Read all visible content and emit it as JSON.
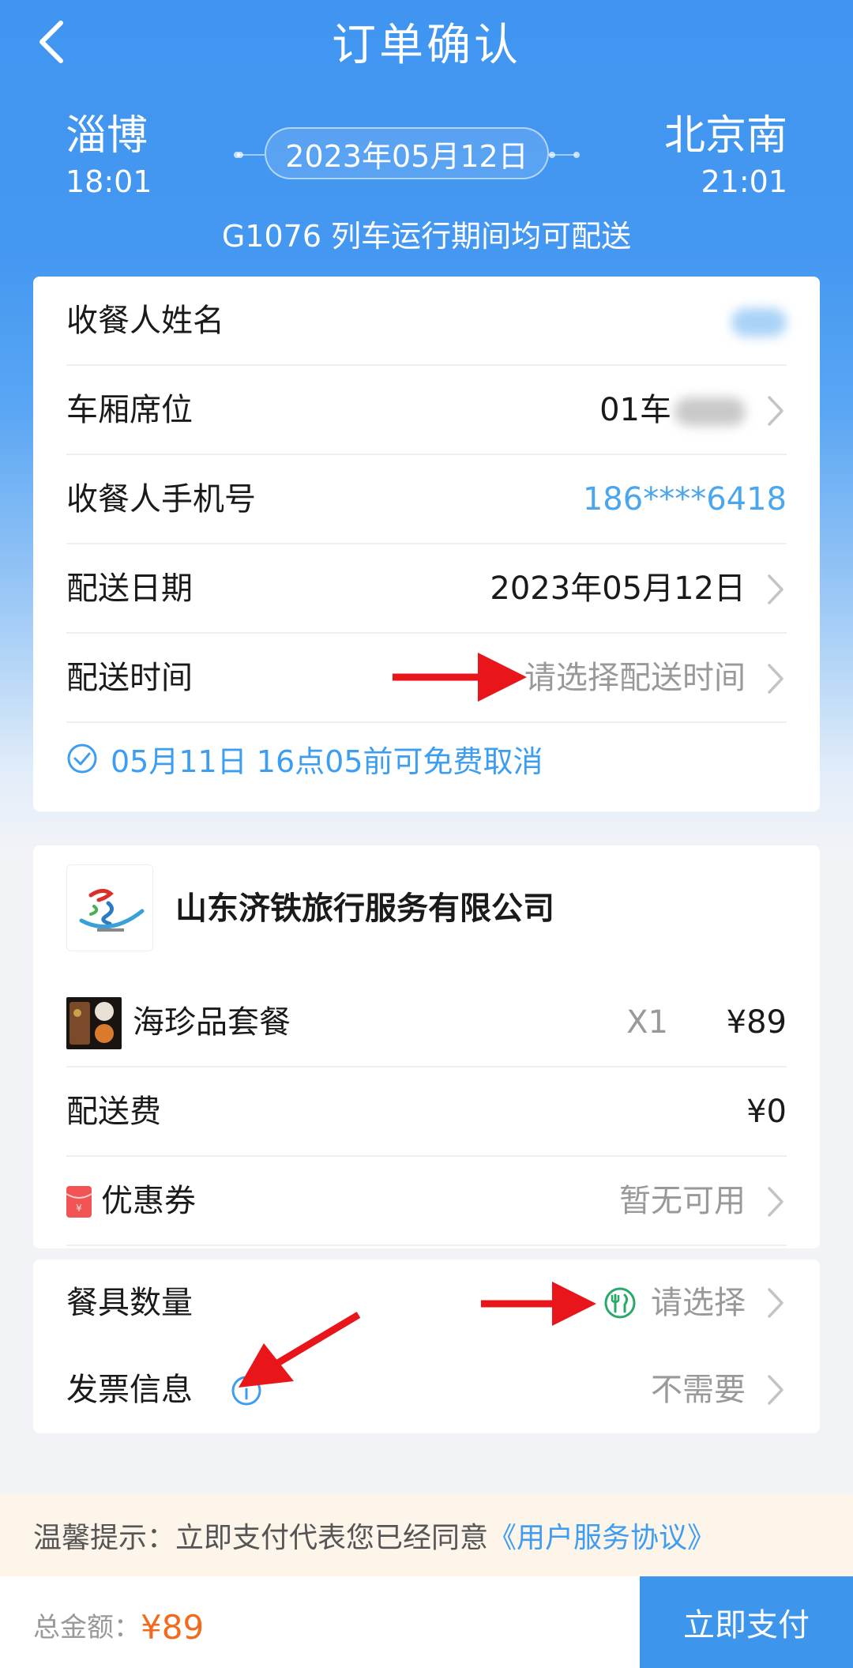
{
  "header": {
    "title": "订单确认",
    "from_station": "淄博",
    "from_time": "18:01",
    "to_station": "北京南",
    "to_time": "21:01",
    "date": "2023年05月12日",
    "train_info": "G1076 列车运行期间均可配送"
  },
  "delivery": {
    "receiver_name_label": "收餐人姓名",
    "seat_label": "车厢席位",
    "seat_value_prefix": "01车",
    "phone_label": "收餐人手机号",
    "phone_value": "186****6418",
    "date_label": "配送日期",
    "date_value": "2023年05月12日",
    "time_label": "配送时间",
    "time_placeholder": "请选择配送时间",
    "cancel_notice": "05月11日 16点05前可免费取消"
  },
  "order": {
    "company": "山东济铁旅行服务有限公司",
    "item_name": "海珍品套餐",
    "item_qty": "X1",
    "item_price": "¥89",
    "fee_label": "配送费",
    "fee_value": "¥0",
    "coupon_label": "优惠券",
    "coupon_value": "暂无可用"
  },
  "extras": {
    "utensils_label": "餐具数量",
    "utensils_value": "请选择",
    "invoice_label": "发票信息",
    "invoice_value": "不需要"
  },
  "tip": {
    "text": "温馨提示：立即支付代表您已经同意",
    "link": "《用户服务协议》"
  },
  "footer": {
    "total_label": "总金额：",
    "total_value": "¥89",
    "pay_button": "立即支付"
  },
  "colors": {
    "primary": "#3d95ec",
    "price": "#f26b1d",
    "annotation_arrow": "#e8161b"
  }
}
